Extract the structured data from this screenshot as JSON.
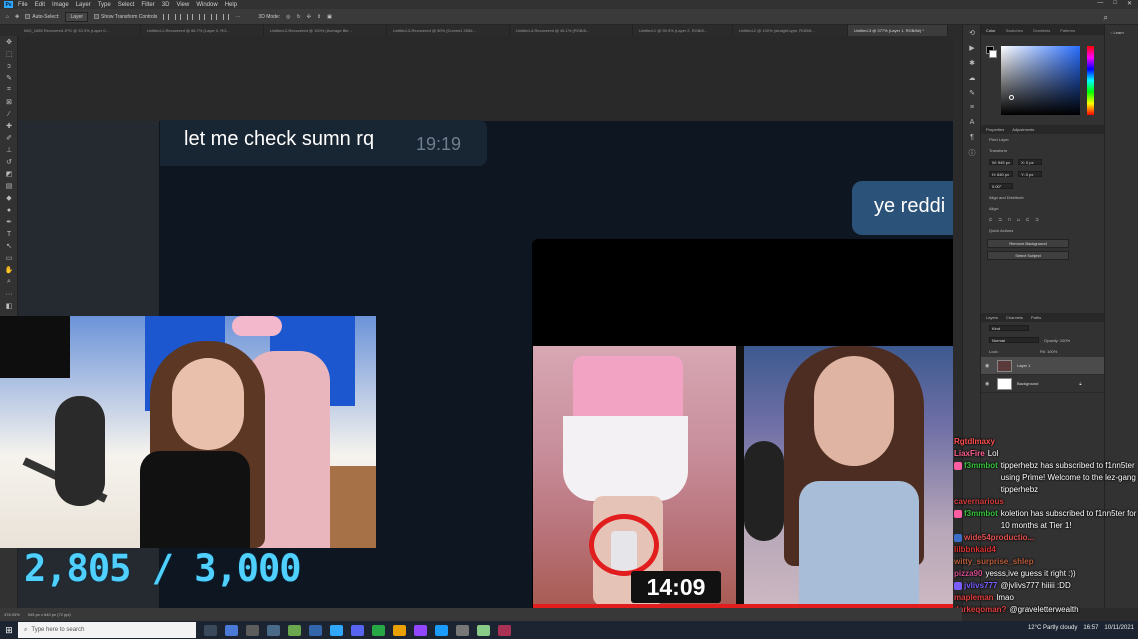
{
  "photoshop": {
    "menu": [
      "File",
      "Edit",
      "Image",
      "Layer",
      "Type",
      "Select",
      "Filter",
      "3D",
      "View",
      "Window",
      "Help"
    ],
    "options": {
      "auto_select_label": "Auto-Select:",
      "auto_select_value": "Layer",
      "transform_label": "Show Transform Controls",
      "mode_label": "3D Mode:"
    },
    "tabs": [
      "IMG_1685 Recovered.JPG @ 33.3% (Layer 0...",
      "Untitled-1-Recovered @ 66.7% (Layer 0, RG...",
      "Untitled-2-Recovered @ 100% (Average Ble...",
      "Untitled-3-Recovered @ 50% (Curves1 2556...",
      "Untitled-4-Recovered @ 45.1% (RGB/8...",
      "Untitled-1 @ 90.9% (Layer 2, RGB/8...",
      "Untitled-2 @ 100% (straight-type, RGB/8...",
      "Untitled-3 @ 377% (Layer 1, RGB/8#) *"
    ],
    "panels": {
      "color_tabs": [
        "Color",
        "Swatches",
        "Gradients",
        "Patterns"
      ],
      "properties_tabs": [
        "Properties",
        "Adjustments"
      ],
      "pixel_layer": "Pixel Layer",
      "transform_label": "Transform",
      "w": "W: 945 px",
      "h": "H: 640 px",
      "x": "X: 0 px",
      "y": "Y: 0 px",
      "angle": "0.00°",
      "align_label": "Align and Distribute",
      "align_sub": "Align:",
      "quick_actions": "Quick Actions",
      "remove_bg": "Remove Background",
      "select_subject": "Select Subject",
      "layers_tabs": [
        "Layers",
        "Channels",
        "Paths"
      ],
      "kind": "Kind",
      "blend": "Normal",
      "opacity": "Opacity: 100%",
      "fill": "Fill: 100%",
      "lock": "Lock:",
      "layers": [
        "Layer 1",
        "Background"
      ],
      "learn": "Learn"
    },
    "status": {
      "zoom": "376.93%",
      "size": "945 px x 640 px (72 ppi)"
    }
  },
  "telegram": {
    "msg_in_text": "let me check sumn rq",
    "msg_in_time": "19:19",
    "msg_out_text": "ye reddi",
    "video_timestamp": "14:09"
  },
  "stream": {
    "sub_counter": "2,805 / 3,000"
  },
  "chat": [
    {
      "user": "Rgtdlmaxy",
      "text": "",
      "color": "#ff4f4f",
      "badge": ""
    },
    {
      "user": "LiaxFire",
      "text": "Lol",
      "color": "#ff5e8f",
      "badge": ""
    },
    {
      "user": "f3mmbot",
      "text": "tipperhebz has subscribed to f1nn5ter using Prime! Welcome to the lez-gang tipperhebz",
      "color": "#36c33f",
      "badge": "#ff5ea3"
    },
    {
      "user": "cavernarious",
      "text": "",
      "color": "#d23c3c",
      "badge": ""
    },
    {
      "user": "f3mmbot",
      "text": "koletion has subscribed to f1nn5ter for 10 months at Tier 1!",
      "color": "#36c33f",
      "badge": "#ff5ea3"
    },
    {
      "user": "wide54productio...",
      "text": "",
      "color": "#e05050",
      "badge": "#3a6ec7"
    },
    {
      "user": "lilbbnkaid4",
      "text": "",
      "color": "#d93030",
      "badge": ""
    },
    {
      "user": "witty_surprise_shlep",
      "text": "",
      "color": "#b95e3e",
      "badge": ""
    },
    {
      "user": "pizza90",
      "text": "yesss,ive guess it right :))",
      "color": "#d14d8c",
      "badge": ""
    },
    {
      "user": "jvlivs777",
      "text": "@jvlivs777 hiiiii :DD",
      "color": "#7a5cff",
      "badge": "#7a5cff"
    },
    {
      "user": "mapleman",
      "text": "lmao",
      "color": "#e03d3d",
      "badge": ""
    },
    {
      "user": "darkeqoman?",
      "text": "@graveletterwealth",
      "color": "#e03d3d",
      "badge": ""
    }
  ],
  "taskbar": {
    "search_placeholder": "Type here to search",
    "weather": "12°C  Partly cloudy",
    "time": "16:57",
    "date": "10/11/2021"
  }
}
